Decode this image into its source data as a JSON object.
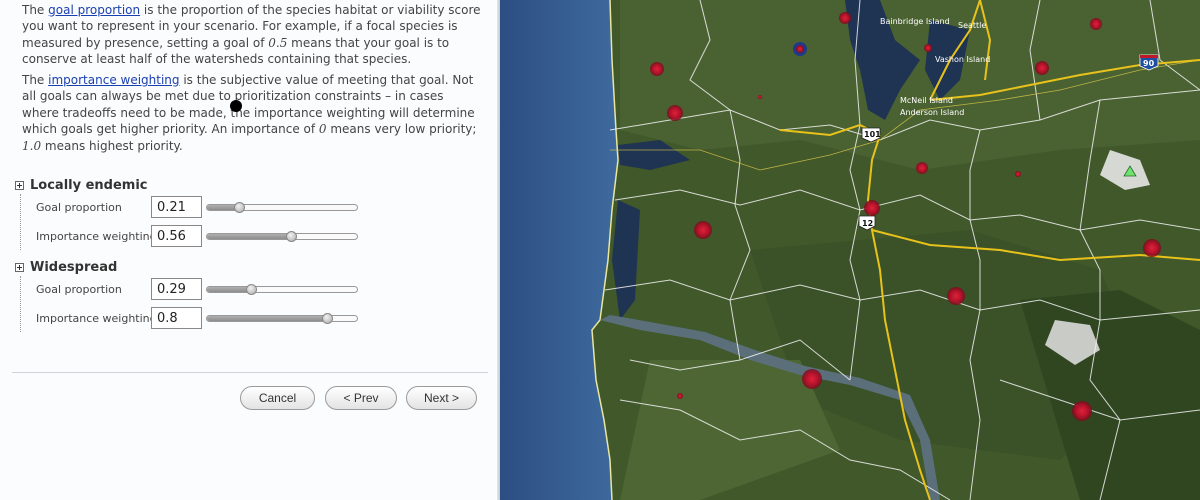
{
  "help": {
    "p1": {
      "before": "The ",
      "link": "goal proportion",
      "mid1": " is the proportion of the species habitat or viability score you want to represent in your scenario. For example, if a focal species is measured by presence, setting a goal of ",
      "em": "0.5",
      "after": " means that your goal is to conserve at least half of the watersheds containing that species."
    },
    "p2": {
      "before": "The ",
      "link": "importance weighting",
      "mid1": " is the subjective value of meeting that goal. Not all goals can always be met due to prioritization constraints – in cases where tradeoffs need to be made, the importance weighting will determine which goals get higher priority. An importance of ",
      "em1": "0",
      "mid2": " means very low priority; ",
      "em2": "1.0",
      "after": " means highest priority."
    }
  },
  "groups": [
    {
      "title": "Locally endemic",
      "rows": [
        {
          "label": "Goal proportion",
          "value": "0.21",
          "level": 0.21
        },
        {
          "label": "Importance weighting",
          "value": "0.56",
          "level": 0.56
        }
      ]
    },
    {
      "title": "Widespread",
      "rows": [
        {
          "label": "Goal proportion",
          "value": "0.29",
          "level": 0.29
        },
        {
          "label": "Importance weighting",
          "value": "0.8",
          "level": 0.8
        }
      ]
    }
  ],
  "buttons": {
    "cancel": "Cancel",
    "prev": "< Prev",
    "next": "Next >"
  },
  "map": {
    "labels": {
      "bainbridge": "Bainbridge Island",
      "seattle": "Seattle",
      "vashon": "Vashon Island",
      "mcneil": "McNeil Island",
      "anderson": "Anderson Island"
    },
    "shields": {
      "us101": "101",
      "us12": "12",
      "i90": "90"
    },
    "colors": {
      "ocean": "#3a5a8c",
      "land": "#3f5a2a",
      "road": "#e8c21a",
      "marker": "#c0182a"
    }
  }
}
